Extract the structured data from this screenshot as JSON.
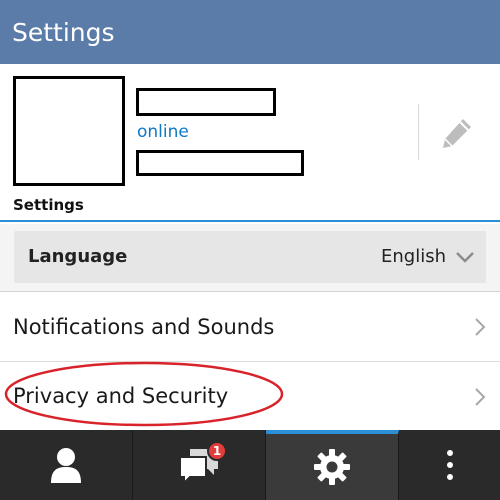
{
  "header": {
    "title": "Settings"
  },
  "profile": {
    "status": "online",
    "label": "Settings",
    "edit_icon": "pencil-icon"
  },
  "language": {
    "label": "Language",
    "value": "English",
    "icon": "chevron-down-icon"
  },
  "menu": {
    "items": [
      {
        "label": "Notifications and Sounds",
        "icon": "chevron-right-icon"
      },
      {
        "label": "Privacy and Security",
        "icon": "chevron-right-icon"
      }
    ]
  },
  "bottom_nav": {
    "tabs": [
      {
        "icon": "person-icon"
      },
      {
        "icon": "chat-bubbles-icon",
        "badge": "1"
      },
      {
        "icon": "gear-icon"
      },
      {
        "icon": "overflow-menu-icon"
      }
    ]
  },
  "colors": {
    "header": "#5b7ba8",
    "accent": "#2b8fd6",
    "status": "#0e78c6",
    "badge": "#e23c3c",
    "annotation": "#d8232a",
    "nav": "#2a2a2a"
  }
}
